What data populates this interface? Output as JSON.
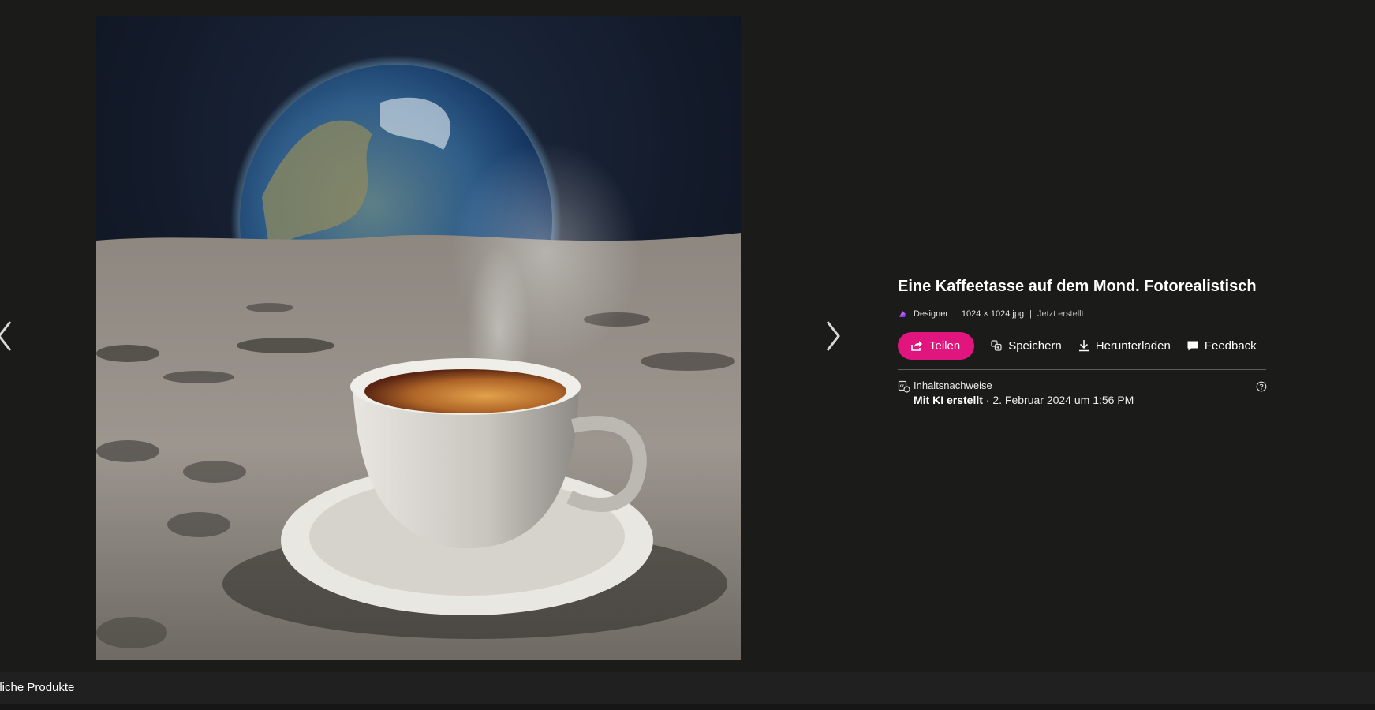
{
  "image": {
    "alt": "Eine Kaffeetasse auf dem Mond. Fotorealistisch"
  },
  "details": {
    "title": "Eine Kaffeetasse auf dem Mond. Fotorealistisch",
    "source": "Designer",
    "dimensions": "1024 × 1024 jpg",
    "created": "Jetzt erstellt",
    "separator": "|"
  },
  "actions": {
    "share": "Teilen",
    "save": "Speichern",
    "download": "Herunterladen",
    "feedback": "Feedback"
  },
  "credits": {
    "label": "Inhaltsnachweise",
    "ai": "Mit KI erstellt",
    "date": " · 2. Februar 2024 um 1:56 PM"
  },
  "bottom": {
    "label": "nliche Produkte"
  },
  "colors": {
    "background": "#1b1b1a",
    "accent": "#e1157e"
  },
  "icons": [
    "chevron-left-icon",
    "chevron-right-icon",
    "designer-icon",
    "share-icon",
    "save-icon",
    "download-icon",
    "feedback-icon",
    "content-credentials-icon",
    "help-icon"
  ]
}
